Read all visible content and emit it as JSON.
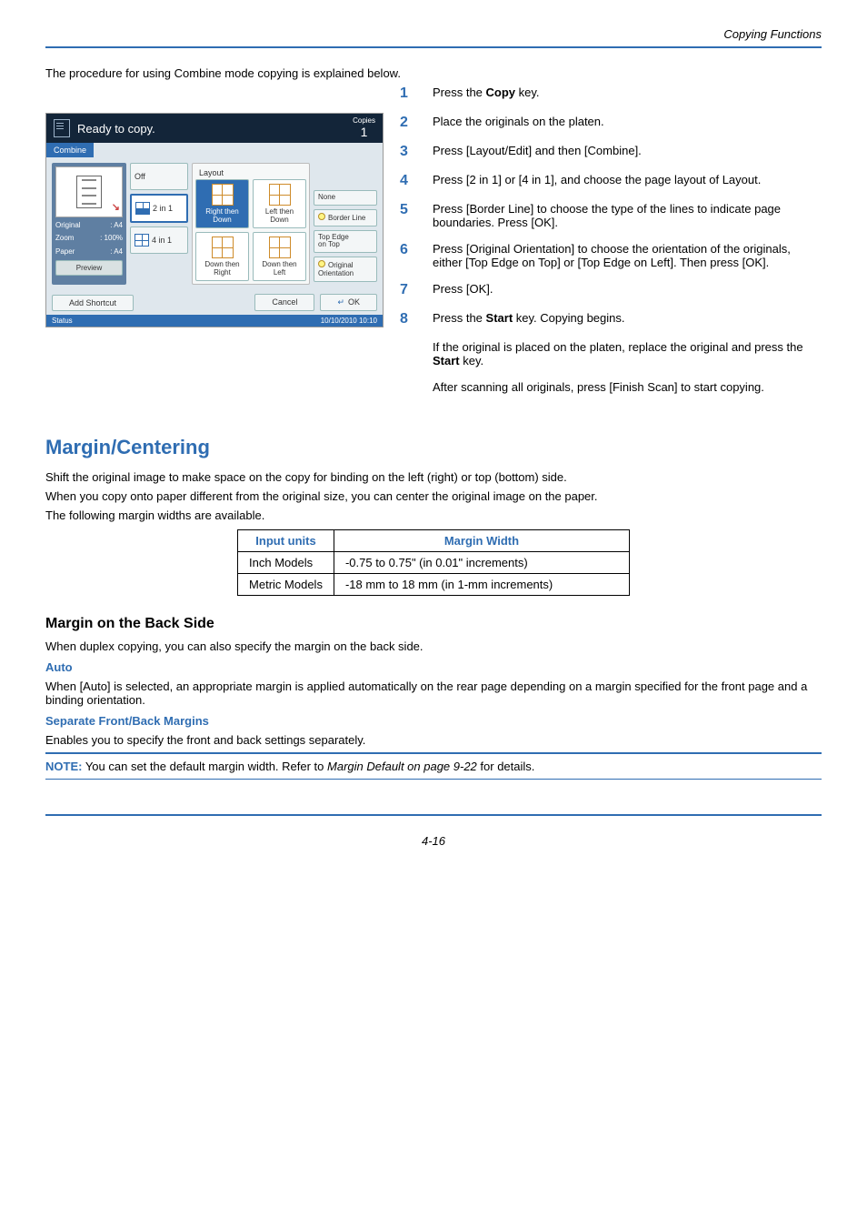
{
  "header": {
    "running": "Copying Functions"
  },
  "intro": "The procedure for using Combine mode copying is explained below.",
  "steps": [
    {
      "html": "Press the <b>Copy</b> key."
    },
    {
      "html": "Place the originals on the platen."
    },
    {
      "html": "Press [Layout/Edit] and then [Combine]."
    },
    {
      "html": "Press [2 in 1] or [4 in 1], and choose the page layout of Layout."
    },
    {
      "html": "Press [Border Line] to choose the type of the lines to indicate page boundaries. Press [OK]."
    },
    {
      "html": "Press [Original Orientation] to choose the orientation of the originals, either [Top Edge on Top] or [Top Edge on Left]. Then press [OK]."
    },
    {
      "html": "Press [OK]."
    },
    {
      "html": "Press the <b>Start</b> key. Copying begins."
    }
  ],
  "after_steps": [
    {
      "html": "If the original is placed on the platen, replace the original and press the <b>Start</b> key."
    },
    {
      "html": "After scanning all originals, press [Finish Scan] to start copying."
    }
  ],
  "margin": {
    "title": "Margin/Centering",
    "p1": "Shift the original image to make space on the copy for binding on the left (right) or top (bottom) side.",
    "p2": "When you copy onto paper different from the original size, you can center the original image on the paper.",
    "p3": "The following margin widths are available.",
    "table": {
      "head": [
        "Input units",
        "Margin Width"
      ],
      "rows": [
        [
          "Inch Models",
          "-0.75 to 0.75\" (in 0.01\" increments)"
        ],
        [
          "Metric Models",
          "-18 mm to 18 mm (in 1-mm increments)"
        ]
      ]
    },
    "back_title": "Margin on the Back Side",
    "back_p": "When duplex copying, you can also specify the margin on the back side.",
    "auto_title": "Auto",
    "auto_p": "When [Auto] is selected, an appropriate margin is applied automatically on the rear page depending on a margin specified for the front page and a binding orientation.",
    "sep_title": "Separate Front/Back Margins",
    "sep_p": "Enables you to specify the front and back settings separately.",
    "note_label": "NOTE:",
    "note_body": " You can set the default margin width. Refer to ",
    "note_ref": "Margin Default on page 9-22",
    "note_tail": " for details."
  },
  "panel": {
    "ready": "Ready to copy.",
    "copies_label": "Copies",
    "copies_value": "1",
    "tab": "Combine",
    "opt_off": "Off",
    "opt_2in1": "2 in 1",
    "opt_4in1": "4 in 1",
    "thumb": {
      "original": "Original",
      "zoom": "Zoom",
      "paper": "Paper",
      "a4_1": ": A4",
      "pct": ": 100%",
      "a4_2": ": A4",
      "preview": "Preview"
    },
    "layout_title": "Layout",
    "layout": {
      "rtd": "Right then\nDown",
      "ltd": "Left then\nDown",
      "dtr": "Down then\nRight",
      "dtl": "Down then\nLeft"
    },
    "side": {
      "none": "None",
      "border": "Border Line",
      "top": "Top Edge\non Top",
      "orient": "Original\nOrientation"
    },
    "footer": {
      "shortcut": "Add Shortcut",
      "cancel": "Cancel",
      "ok": "OK"
    },
    "status": "Status",
    "timestamp": "10/10/2010 10:10"
  },
  "page_num": "4-16"
}
